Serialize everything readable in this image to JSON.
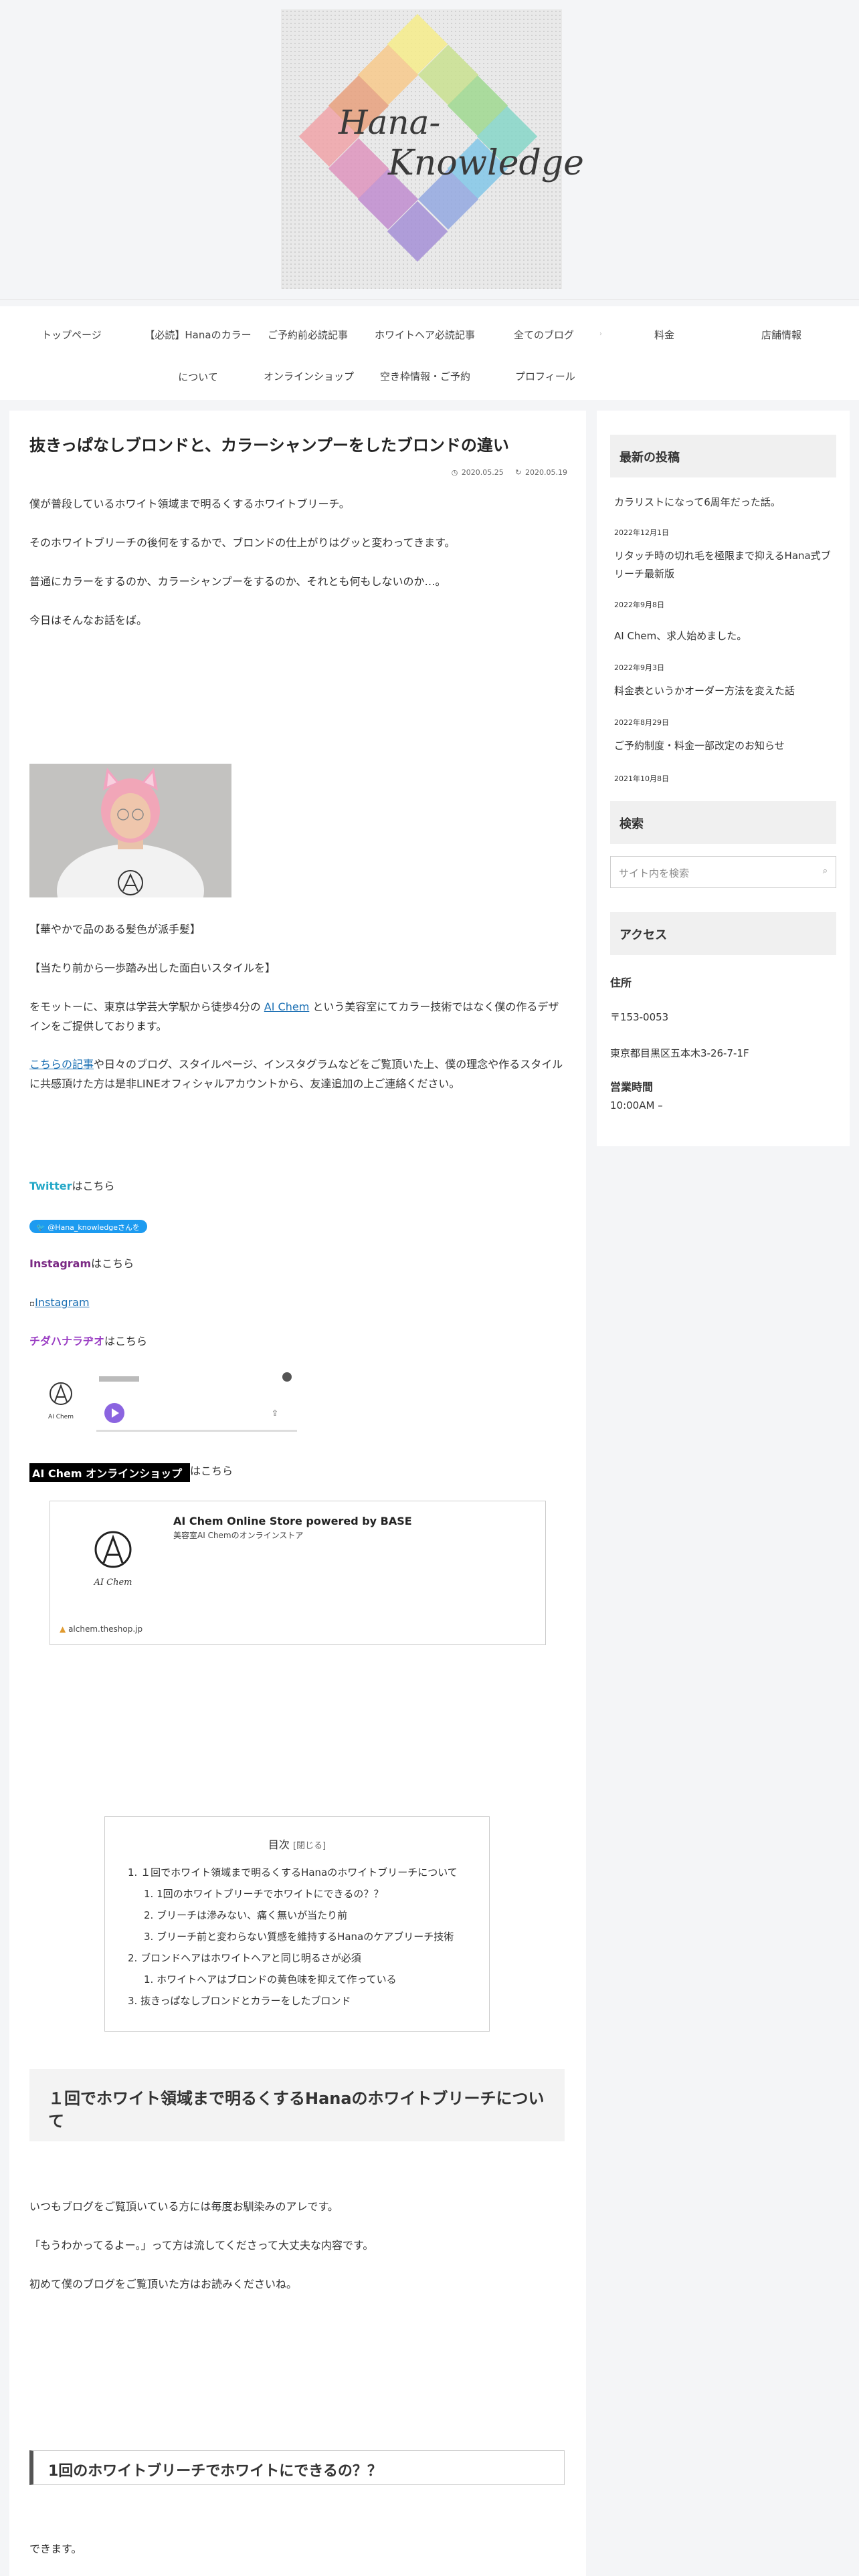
{
  "logo": {
    "word1": "Hana-",
    "word2": "Knowledge"
  },
  "nav": {
    "items": [
      {
        "label": "トップページ"
      },
      {
        "label": "【必読】Hanaのカラーについて"
      },
      {
        "label": "ご予約前必読記事"
      },
      {
        "label": "ホワイトヘア必読記事"
      },
      {
        "label": "全てのブログ"
      },
      {
        "label": "料金"
      },
      {
        "label": "店舗情報"
      },
      {
        "label": "オンラインショップ"
      },
      {
        "label": "空き枠情報・ご予約"
      },
      {
        "label": "プロフィール"
      }
    ],
    "item1_line1": "【必読】Hanaのカラー",
    "item1_line2": "について"
  },
  "post": {
    "title": "抜きっぱなしブロンドと、カラーシャンプーをしたブロンドの違い",
    "published": "2020.05.25",
    "updated": "2020.05.19",
    "p1": "僕が普段しているホワイト領域まで明るくするホワイトブリーチ。",
    "p2": "そのホワイトブリーチの後何をするかで、ブロンドの仕上がりはグッと変わってきます。",
    "p3": "普通にカラーをするのか、カラーシャンプーをするのか、それとも何もしないのか…。",
    "p4": "今日はそんなお話をば。",
    "p5": "【華やかで品のある髪色が派手髪】",
    "p6": "【当たり前から一歩踏み出した面白いスタイルを】",
    "p7_pre": "をモットーに、東京は学芸大学駅から徒歩4分の ",
    "p7_link": "AI Chem",
    "p7_post": " という美容室にてカラー技術ではなく僕の作るデザインをご提供しております。",
    "p8_link": "こちらの記事",
    "p8_post": "や日々のブログ、スタイルページ、インスタグラムなどをご覧頂いた上、僕の理念や作るスタイルに共感頂けた方は是非LINEオフィシャルアカウントから、友達追加の上ご連絡ください。",
    "twitter_label": "Twitter",
    "twitter_suffix": "はこちら",
    "twitter_button": "@Hana_knowledgeさんをフォロー",
    "instagram_label": "Instagram",
    "instagram_suffix": "はこちら",
    "instagram_link": "Instagram",
    "chida_label": "チダハナラヂオ",
    "chida_suffix": "はこちら",
    "audio_brand": "AI Chem",
    "shop_label": "AI Chem オンラインショップ",
    "shop_suffix": "はこちら",
    "shop_card_title": "AI Chem Online Store powered by BASE",
    "shop_card_desc": "美容室AI Chemのオンラインストア",
    "shop_card_brand": "AI Chem",
    "shop_card_url": "alchem.theshop.jp"
  },
  "toc": {
    "title": "目次",
    "toggle": "[閉じる]",
    "items": [
      "1. １回でホワイト領域まで明るくするHanaのホワイトブリーチについて",
      "1. 1回のホワイトブリーチでホワイトにできるの？？",
      "2. ブリーチは滲みない、痛く無いが当たり前",
      "3. ブリーチ前と変わらない質感を維持するHanaのケアブリーチ技術",
      "2. ブロンドヘアはホワイトヘアと同じ明るさが必須",
      "1. ホワイトヘアはブロンドの黄色味を抑えて作っている",
      "3. 抜きっぱなしブロンドとカラーをしたブロンド"
    ]
  },
  "section1": {
    "heading": "１回でホワイト領域まで明るくするHanaのホワイトブリーチについて",
    "p1": "いつもブログをご覧頂いている方には毎度お馴染みのアレです。",
    "p2": "「もうわかってるよー。」って方は流してくださって大丈夫な内容です。",
    "p3": "初めて僕のブログをご覧頂いた方はお読みくださいね。",
    "sub_heading": "1回のホワイトブリーチでホワイトにできるの？？",
    "p4": "できます。"
  },
  "sidebar": {
    "recent_title": "最新の投稿",
    "posts": [
      {
        "title": "カラリストになって6周年だった話。",
        "date": "2022年12月1日"
      },
      {
        "title": "リタッチ時の切れ毛を極限まで抑えるHana式ブリーチ最新版",
        "date": "2022年9月8日"
      },
      {
        "title": "AI Chem、求人始めました。",
        "date": "2022年9月3日"
      },
      {
        "title": "料金表というかオーダー方法を変えた話",
        "date": "2022年8月29日"
      },
      {
        "title": "ご予約制度・料金一部改定のお知らせ",
        "date": "2021年10月8日"
      }
    ],
    "search_title": "検索",
    "search_placeholder": "サイト内を検索",
    "access_title": "アクセス",
    "address_label": "住所",
    "postal": "〒153-0053",
    "address": "東京都目黒区五本木3-26-7-1F",
    "hours_label": "営業時間",
    "hours": "10:00AM –"
  }
}
